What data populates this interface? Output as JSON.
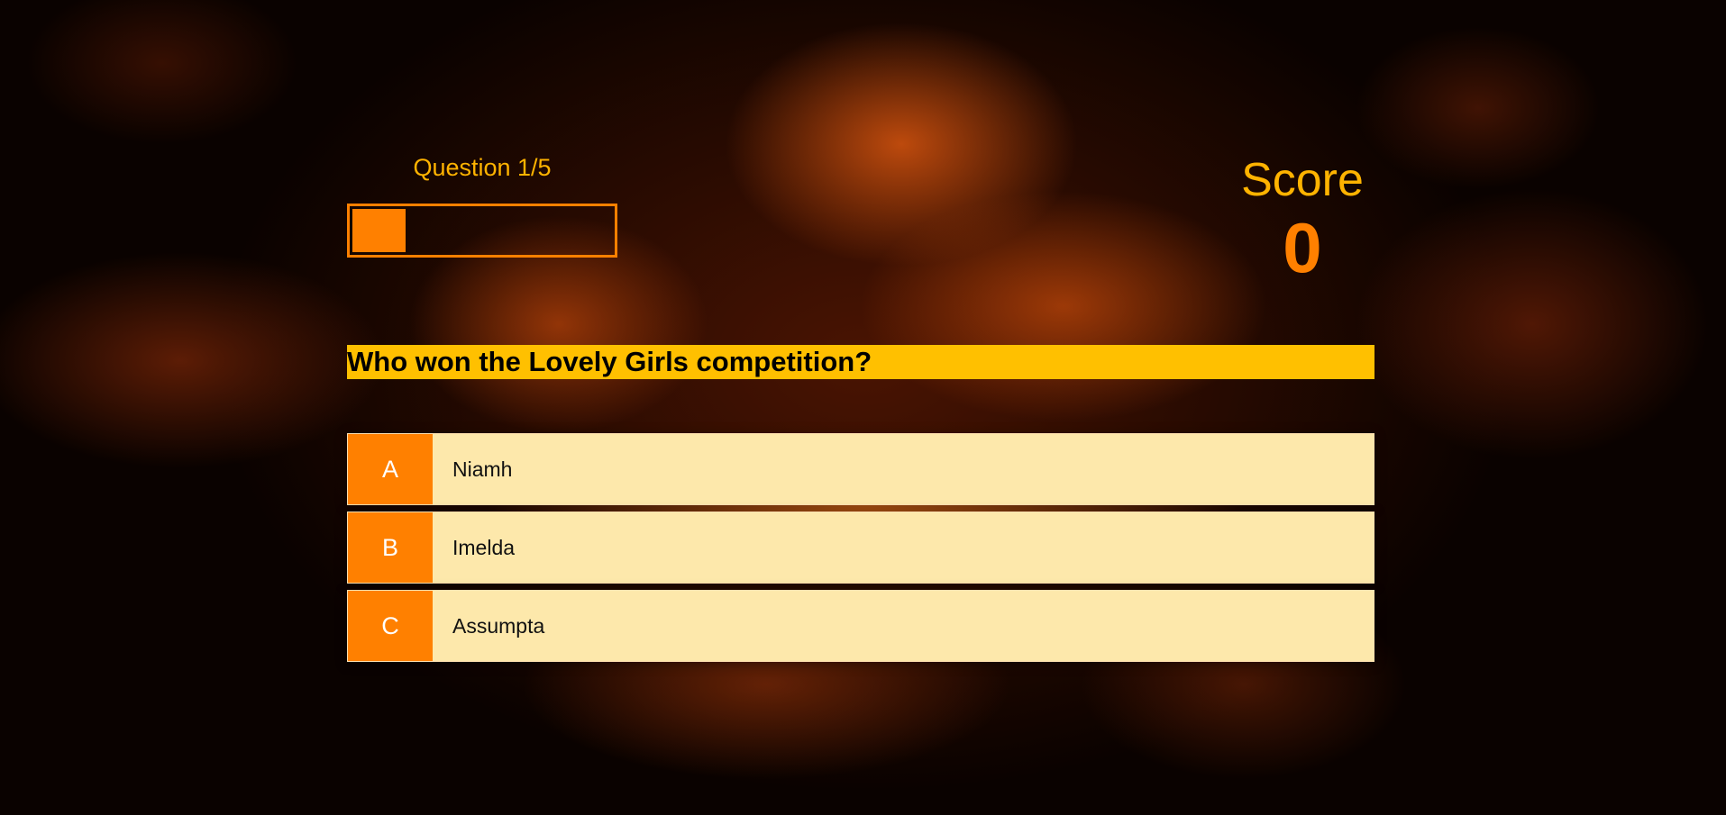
{
  "colors": {
    "accent": "#ff8000",
    "score_label": "#ffb300",
    "question_bg": "#ffc000",
    "choice_bg": "#fde8ab"
  },
  "hud": {
    "progress_text": "Question 1/5",
    "progress_fraction": 0.2,
    "score_label": "Score",
    "score_value": "0"
  },
  "question": "Who won the Lovely Girls competition?",
  "choices": [
    {
      "prefix": "A",
      "text": "Niamh"
    },
    {
      "prefix": "B",
      "text": "Imelda"
    },
    {
      "prefix": "C",
      "text": "Assumpta"
    }
  ]
}
